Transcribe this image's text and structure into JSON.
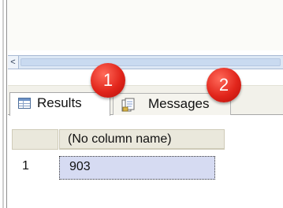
{
  "editor": {
    "scroll_left_glyph": "<"
  },
  "tabs": [
    {
      "label": "Results",
      "icon": "grid-results-icon",
      "selected": true
    },
    {
      "label": "Messages",
      "icon": "messages-document-icon",
      "selected": false
    }
  ],
  "annotations": [
    {
      "number": "1",
      "color": "#e1251b"
    },
    {
      "number": "2",
      "color": "#e1251b"
    }
  ],
  "grid": {
    "columns": [
      "(No column name)"
    ],
    "rows": [
      {
        "row_number": "1",
        "values": [
          "903"
        ]
      }
    ],
    "selection_color": "#d6dbf2"
  }
}
